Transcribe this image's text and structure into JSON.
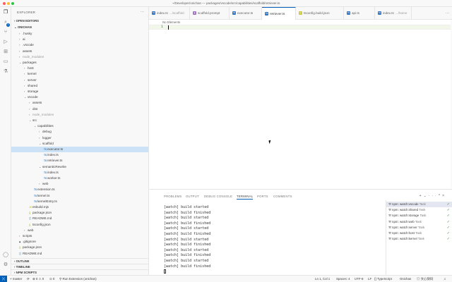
{
  "window": {
    "title": "~/Developer/onichan — packages/vscode/src/capabilities/scaffold/retriever.ts"
  },
  "colors": {
    "accent": "#005fb8",
    "traffic_red": "#ff5f57",
    "traffic_yellow": "#febc2e",
    "traffic_green": "#28c840",
    "ts_blue": "#3178c6",
    "json_yellow": "#cbcb41",
    "success": "#388a34"
  },
  "activity": [
    "files-icon",
    "search-icon",
    "source-control-icon",
    "run-debug-icon",
    "extensions-icon",
    "remote-explorer-icon",
    "testing-icon",
    "account-icon",
    "settings-gear-icon"
  ],
  "activity_badge": "1",
  "sidebar": {
    "title": "EXPLORER",
    "open_editors": "OPEN EDITORS",
    "root": "ONICHAN",
    "tree": [
      {
        "label": ".husky",
        "kind": "folder",
        "depth": 1,
        "open": false
      },
      {
        "label": "ai",
        "kind": "folder",
        "depth": 1,
        "open": false
      },
      {
        "label": ".vscode",
        "kind": "folder",
        "depth": 1,
        "open": false
      },
      {
        "label": "assets",
        "kind": "folder",
        "depth": 1,
        "open": false
      },
      {
        "label": "node_modules",
        "kind": "folder",
        "depth": 1,
        "open": false,
        "dim": true
      },
      {
        "label": "packages",
        "kind": "folder",
        "depth": 1,
        "open": true
      },
      {
        "label": "host",
        "kind": "folder",
        "depth": 2,
        "open": false
      },
      {
        "label": "kernel",
        "kind": "folder",
        "depth": 2,
        "open": false
      },
      {
        "label": "server",
        "kind": "folder",
        "depth": 2,
        "open": false
      },
      {
        "label": "shared",
        "kind": "folder",
        "depth": 2,
        "open": false
      },
      {
        "label": "storage",
        "kind": "folder",
        "depth": 2,
        "open": false
      },
      {
        "label": "vscode",
        "kind": "folder",
        "depth": 2,
        "open": true
      },
      {
        "label": "assets",
        "kind": "folder",
        "depth": 3,
        "open": false
      },
      {
        "label": "dist",
        "kind": "folder",
        "depth": 3,
        "open": false
      },
      {
        "label": "node_modules",
        "kind": "folder",
        "depth": 3,
        "open": false,
        "dim": true
      },
      {
        "label": "src",
        "kind": "folder",
        "depth": 3,
        "open": true
      },
      {
        "label": "capabilities",
        "kind": "folder",
        "depth": 4,
        "open": true
      },
      {
        "label": "debug",
        "kind": "folder",
        "depth": 5,
        "open": false
      },
      {
        "label": "logger",
        "kind": "folder",
        "depth": 5,
        "open": false
      },
      {
        "label": "scaffold",
        "kind": "folder",
        "depth": 5,
        "open": true
      },
      {
        "label": "executor.ts",
        "kind": "ts",
        "depth": 6,
        "active": true
      },
      {
        "label": "index.ts",
        "kind": "ts",
        "depth": 6
      },
      {
        "label": "retriever.ts",
        "kind": "ts",
        "depth": 6
      },
      {
        "label": "semanticRewrite",
        "kind": "folder",
        "depth": 5,
        "open": true
      },
      {
        "label": "index.ts",
        "kind": "ts",
        "depth": 6
      },
      {
        "label": "worker.ts",
        "kind": "ts",
        "depth": 6
      },
      {
        "label": "web",
        "kind": "folder",
        "depth": 5,
        "open": false
      },
      {
        "label": "extension.ts",
        "kind": "ts",
        "depth": 4
      },
      {
        "label": "kernel.ts",
        "kind": "ts",
        "depth": 4
      },
      {
        "label": "kernelEntry.ts",
        "kind": "ts",
        "depth": 4
      },
      {
        "label": "esbuild.mjs",
        "kind": "js",
        "depth": 3
      },
      {
        "label": "package.json",
        "kind": "json",
        "depth": 3
      },
      {
        "label": "README.md",
        "kind": "md",
        "depth": 3
      },
      {
        "label": "tsconfig.json",
        "kind": "json",
        "depth": 3
      },
      {
        "label": "web",
        "kind": "folder",
        "depth": 2,
        "open": false
      },
      {
        "label": "scripts",
        "kind": "folder",
        "depth": 1,
        "open": false
      },
      {
        "label": ".gitignore",
        "kind": "git",
        "depth": 1
      },
      {
        "label": "package.json",
        "kind": "json",
        "depth": 1
      },
      {
        "label": "README.md",
        "kind": "md",
        "depth": 1
      }
    ],
    "outline": "OUTLINE",
    "timeline": "TIMELINE",
    "npm_scripts": "NPM SCRIPTS"
  },
  "tabs": [
    {
      "label": "index.ts",
      "desc": ".../scaffold",
      "icon": "ts"
    },
    {
      "label": "scaffold.prompt",
      "desc": "",
      "icon": "prompt"
    },
    {
      "label": "executor.ts",
      "desc": "",
      "icon": "ts"
    },
    {
      "label": "retriever.ts",
      "desc": "",
      "icon": "ts",
      "active": true
    },
    {
      "label": "tsconfig.build.json",
      "desc": "",
      "icon": "json"
    },
    {
      "label": "api.ts",
      "desc": "",
      "icon": "ts"
    },
    {
      "label": "index.ts",
      "desc": ".../home",
      "icon": "ts"
    }
  ],
  "editor": {
    "breadcrumb": "No Elements",
    "line_number": "1"
  },
  "panel": {
    "tabs": [
      "PROBLEMS",
      "OUTPUT",
      "DEBUG CONSOLE",
      "TERMINAL",
      "PORTS",
      "COMMENTS"
    ],
    "active_tab": "TERMINAL",
    "terminal_lines": [
      "[watch] build started",
      "[watch] build finished",
      "[watch] build started",
      "[watch] build finished",
      "[watch] build started",
      "[watch] build finished",
      "[watch] build started",
      "[watch] build finished",
      "[watch] build started",
      "[watch] build finished",
      "[watch] build started",
      "[watch] build finished"
    ],
    "tasks": [
      {
        "label": "npm: watch:vscode",
        "suffix": "Task",
        "selected": true
      },
      {
        "label": "npm: watch:shared",
        "suffix": "Task"
      },
      {
        "label": "npm: watch:storage",
        "suffix": "Task"
      },
      {
        "label": "npm: watch:web",
        "suffix": "Task"
      },
      {
        "label": "npm: watch:server",
        "suffix": "Task"
      },
      {
        "label": "npm: watch:host",
        "suffix": "Task"
      },
      {
        "label": "npm: watch:kernel",
        "suffix": "Task"
      }
    ]
  },
  "status": {
    "branch": "master",
    "errors": "0",
    "warnings": "0",
    "ports": "0",
    "run_ext": "Run Extension (onichan)",
    "position": "Ln 1, Col 1",
    "spaces": "Spaces: 4",
    "encoding": "UTF-8",
    "eol": "LF",
    "language": "TypeScript",
    "user": "Onichan",
    "ai_status": "文心快码"
  }
}
